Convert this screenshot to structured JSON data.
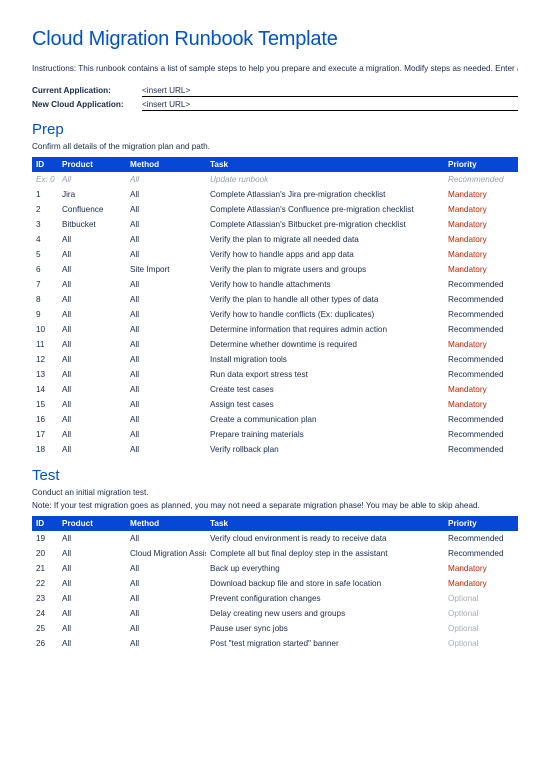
{
  "title": "Cloud Migration Runbook Template",
  "instructions": "Instructions: This runbook contains a list of sample steps to help you prepare and execute a migration. Modify steps as needed. Enter any additional details needed to complete the task.",
  "fields": {
    "currentLabel": "Current Application:",
    "currentValue": "<insert URL>",
    "newLabel": "New Cloud Application:",
    "newValue": "<insert URL>"
  },
  "columns": {
    "id": "ID",
    "product": "Product",
    "method": "Method",
    "task": "Task",
    "priority": "Priority"
  },
  "prep": {
    "heading": "Prep",
    "desc": "Confirm all details of the migration plan and path.",
    "example": {
      "id": "Ex: 0",
      "product": "All",
      "method": "All",
      "task": "Update runbook",
      "priority": "Recommended"
    },
    "rows": [
      {
        "id": "1",
        "product": "Jira",
        "method": "All",
        "task": "Complete Atlassian's Jira pre-migration checklist",
        "priority": "Mandatory"
      },
      {
        "id": "2",
        "product": "Confluence",
        "method": "All",
        "task": "Complete Atlassian's Confluence pre-migration checklist",
        "priority": "Mandatory"
      },
      {
        "id": "3",
        "product": "Bitbucket",
        "method": "All",
        "task": "Complete Atlassian's Bitbucket pre-migration checklist",
        "priority": "Mandatory"
      },
      {
        "id": "4",
        "product": "All",
        "method": "All",
        "task": "Verify the plan to migrate all needed data",
        "priority": "Mandatory"
      },
      {
        "id": "5",
        "product": "All",
        "method": "All",
        "task": "Verify how to handle apps and app data",
        "priority": "Mandatory"
      },
      {
        "id": "6",
        "product": "All",
        "method": "Site Import",
        "task": "Verify the plan to migrate users and groups",
        "priority": "Mandatory"
      },
      {
        "id": "7",
        "product": "All",
        "method": "All",
        "task": "Verify how to handle attachments",
        "priority": "Recommended"
      },
      {
        "id": "8",
        "product": "All",
        "method": "All",
        "task": "Verify the plan to handle all other types of data",
        "priority": "Recommended"
      },
      {
        "id": "9",
        "product": "All",
        "method": "All",
        "task": "Verify how to handle conflicts (Ex: duplicates)",
        "priority": "Recommended"
      },
      {
        "id": "10",
        "product": "All",
        "method": "All",
        "task": "Determine information that requires admin action",
        "priority": "Recommended"
      },
      {
        "id": "11",
        "product": "All",
        "method": "All",
        "task": "Determine whether downtime is required",
        "priority": "Mandatory"
      },
      {
        "id": "12",
        "product": "All",
        "method": "All",
        "task": "Install migration tools",
        "priority": "Recommended"
      },
      {
        "id": "13",
        "product": "All",
        "method": "All",
        "task": "Run data export stress test",
        "priority": "Recommended"
      },
      {
        "id": "14",
        "product": "All",
        "method": "All",
        "task": "Create test cases",
        "priority": "Mandatory"
      },
      {
        "id": "15",
        "product": "All",
        "method": "All",
        "task": "Assign test cases",
        "priority": "Mandatory"
      },
      {
        "id": "16",
        "product": "All",
        "method": "All",
        "task": "Create a communication plan",
        "priority": "Recommended"
      },
      {
        "id": "17",
        "product": "All",
        "method": "All",
        "task": "Prepare training materials",
        "priority": "Recommended"
      },
      {
        "id": "18",
        "product": "All",
        "method": "All",
        "task": "Verify rollback plan",
        "priority": "Recommended"
      }
    ]
  },
  "test": {
    "heading": "Test",
    "desc": "Conduct an initial migration test.",
    "note": "Note: If your test migration goes as planned, you may not need a separate migration phase! You may be able to skip ahead.",
    "rows": [
      {
        "id": "19",
        "product": "All",
        "method": "All",
        "task": "Verify cloud environment is ready to receive data",
        "priority": "Recommended"
      },
      {
        "id": "20",
        "product": "All",
        "method": "Cloud Migration Assistant",
        "task": "Complete all but final deploy step in the assistant",
        "priority": "Recommended"
      },
      {
        "id": "21",
        "product": "All",
        "method": "All",
        "task": "Back up everything",
        "priority": "Mandatory"
      },
      {
        "id": "22",
        "product": "All",
        "method": "All",
        "task": "Download backup file and store in safe location",
        "priority": "Mandatory"
      },
      {
        "id": "23",
        "product": "All",
        "method": "All",
        "task": "Prevent configuration changes",
        "priority": "Optional"
      },
      {
        "id": "24",
        "product": "All",
        "method": "All",
        "task": "Delay creating new users and groups",
        "priority": "Optional"
      },
      {
        "id": "25",
        "product": "All",
        "method": "All",
        "task": "Pause user sync jobs",
        "priority": "Optional"
      },
      {
        "id": "26",
        "product": "All",
        "method": "All",
        "task": "Post \"test migration started\" banner",
        "priority": "Optional"
      }
    ]
  }
}
